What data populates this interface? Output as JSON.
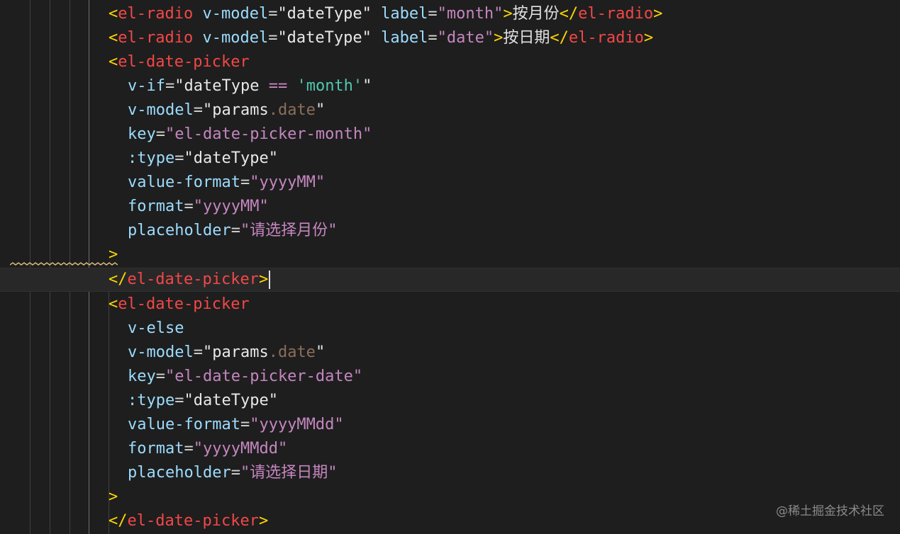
{
  "editor": {
    "lines": [
      {
        "tag_open": "<",
        "tag": "el-radio",
        "a1": "v-model",
        "eq1": "=",
        "v1": "\"dateType\"",
        "a2": "label",
        "eq2": "=",
        "v2": "\"month\"",
        "gt": ">",
        "text": "按月份",
        "close_open": "</",
        "close_tag": "el-radio",
        "close_gt": ">"
      },
      {
        "tag_open": "<",
        "tag": "el-radio",
        "a1": "v-model",
        "eq1": "=",
        "v1": "\"dateType\"",
        "a2": "label",
        "eq2": "=",
        "v2": "\"date\"",
        "gt": ">",
        "text": "按日期",
        "close_open": "</",
        "close_tag": "el-radio",
        "close_gt": ">"
      }
    ],
    "picker1": {
      "open_lt": "<",
      "open_tag": "el-date-picker",
      "vif_attr": "v-if",
      "vif_q1": "\"",
      "vif_var": "dateType",
      "vif_op": "==",
      "vif_str": "'month'",
      "vif_q2": "\"",
      "vmodel_attr": "v-model",
      "vmodel_q1": "\"",
      "vmodel_obj": "params",
      "vmodel_prop": ".date",
      "vmodel_q2": "\"",
      "key_attr": "key",
      "key_val": "\"el-date-picker-month\"",
      "type_attr": ":type",
      "type_val": "\"dateType\"",
      "vf_attr": "value-format",
      "vf_val": "\"yyyyMM\"",
      "fmt_attr": "format",
      "fmt_val": "\"yyyyMM\"",
      "ph_attr": "placeholder",
      "ph_q1": "\"",
      "ph_text": "请选择月份",
      "ph_q2": "\"",
      "gt": ">",
      "close_lt": "</",
      "close_tag": "el-date-picker",
      "close_gt": ">"
    },
    "picker2": {
      "open_lt": "<",
      "open_tag": "el-date-picker",
      "velse_attr": "v-else",
      "vmodel_attr": "v-model",
      "vmodel_q1": "\"",
      "vmodel_obj": "params",
      "vmodel_prop": ".date",
      "vmodel_q2": "\"",
      "key_attr": "key",
      "key_val": "\"el-date-picker-date\"",
      "type_attr": ":type",
      "type_val": "\"dateType\"",
      "vf_attr": "value-format",
      "vf_val": "\"yyyyMMdd\"",
      "fmt_attr": "format",
      "fmt_val": "\"yyyyMMdd\"",
      "ph_attr": "placeholder",
      "ph_q1": "\"",
      "ph_text": "请选择日期",
      "ph_q2": "\"",
      "gt": ">",
      "close_lt": "</",
      "close_tag": "el-date-picker",
      "close_gt": ">"
    }
  },
  "watermark": "@稀土掘金技术社区",
  "colors": {
    "background": "#1e1e1e",
    "tag": "#f44747",
    "bracket": "#ffd700",
    "attribute": "#9cdcfe",
    "string": "#c586c0"
  }
}
